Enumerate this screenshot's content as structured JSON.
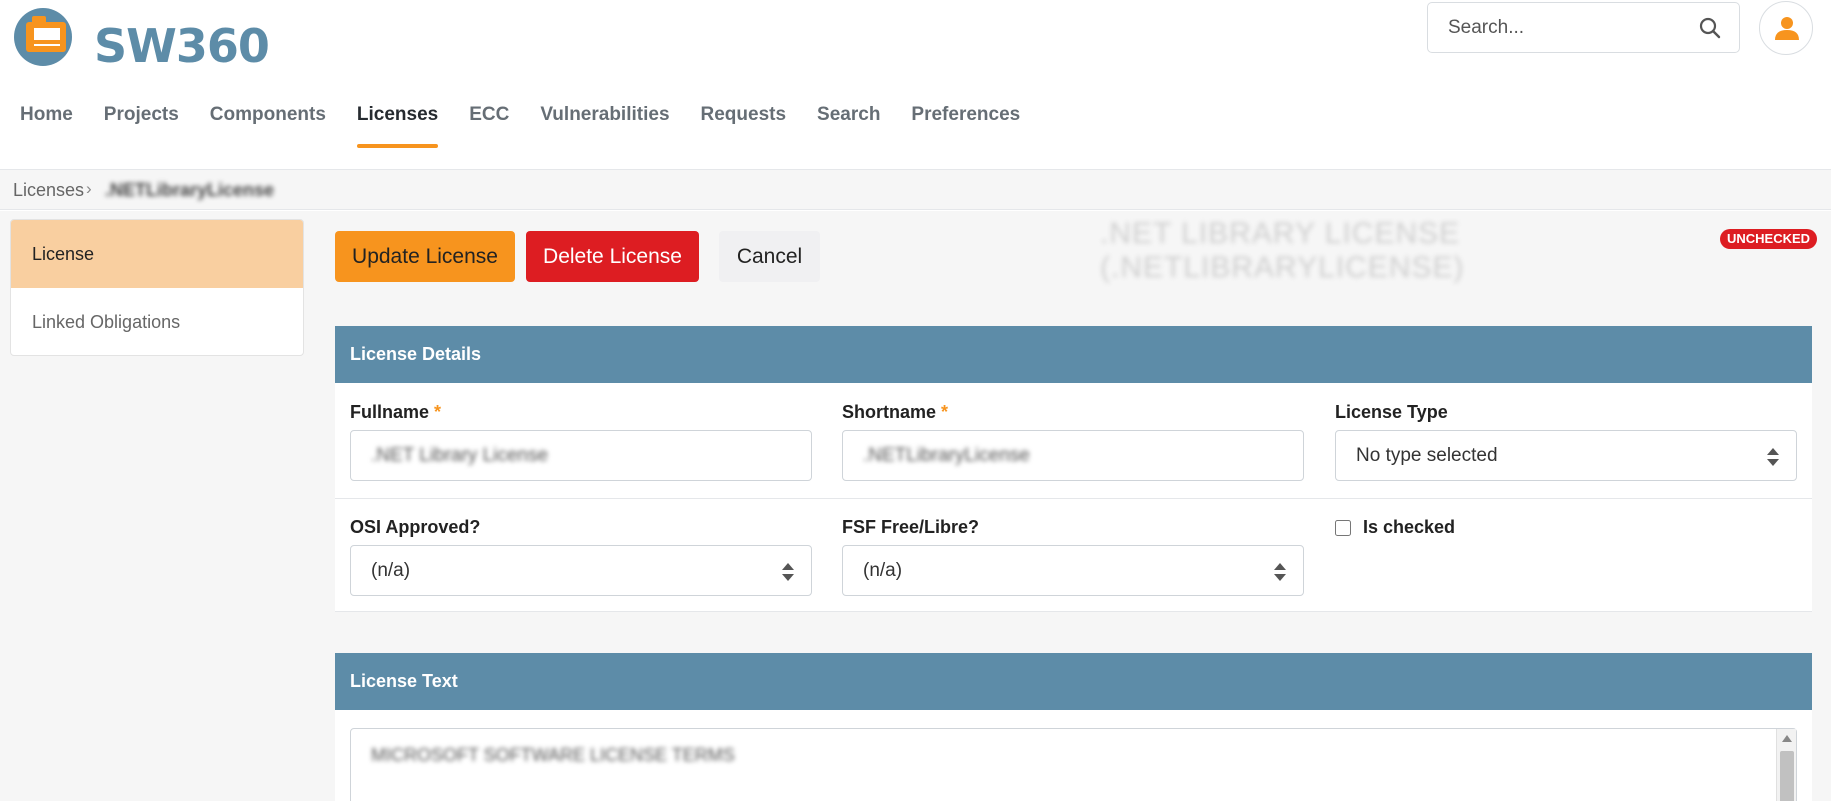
{
  "header": {
    "logo_text": "SW360",
    "search_placeholder": "Search..."
  },
  "nav": {
    "items": [
      "Home",
      "Projects",
      "Components",
      "Licenses",
      "ECC",
      "Vulnerabilities",
      "Requests",
      "Search",
      "Preferences"
    ],
    "active": "Licenses"
  },
  "breadcrumb": {
    "root": "Licenses",
    "separator": "›",
    "current": ".NETLibraryLicense"
  },
  "sidebar": {
    "items": [
      "License",
      "Linked Obligations"
    ],
    "active": "License"
  },
  "actions": {
    "update": "Update License",
    "delete": "Delete License",
    "cancel": "Cancel"
  },
  "license_title": ".NET LIBRARY LICENSE (.NETLIBRARYLICENSE)",
  "status_badge": "UNCHECKED",
  "details": {
    "heading": "License Details",
    "fullname_label": "Fullname",
    "fullname_value": ".NET Library License",
    "shortname_label": "Shortname",
    "shortname_value": ".NETLibraryLicense",
    "required_mark": "*",
    "license_type_label": "License Type",
    "license_type_value": "No type selected",
    "osi_label": "OSI Approved?",
    "osi_value": "(n/a)",
    "fsf_label": "FSF Free/Libre?",
    "fsf_value": "(n/a)",
    "is_checked_label": "Is checked",
    "is_checked": false
  },
  "license_text": {
    "heading": "License Text",
    "value": "MICROSOFT SOFTWARE LICENSE TERMS"
  },
  "colors": {
    "accent": "#f7941e",
    "danger": "#dd1d22",
    "panel_header": "#5d8ca8",
    "sidebar_active": "#f9cfa0"
  }
}
